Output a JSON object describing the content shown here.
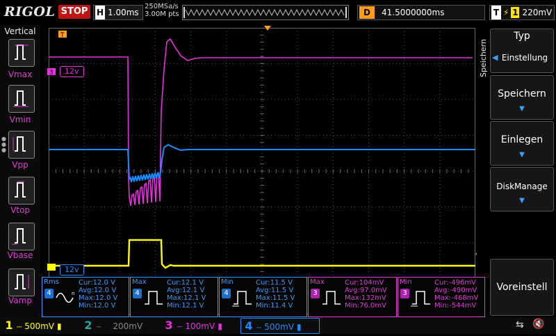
{
  "topbar": {
    "brand": "RIGOL",
    "run_state": "STOP",
    "timebase_key": "H",
    "timebase": "1.00ms",
    "sample_rate": "250MSa/s",
    "memory_depth": "3.00M pts",
    "delay_key": "D",
    "delay": "41.5000000ms",
    "trigger_key": "T",
    "trigger_channel": "1",
    "trigger_level": "220mV",
    "colors": {
      "stop": "#c01515",
      "delay": "#ff9c1a",
      "trigger": "#ffe500"
    }
  },
  "left_panel": {
    "title": "Vertical",
    "items": [
      {
        "label": "Vmax",
        "icon": "vmax-icon"
      },
      {
        "label": "Vmin",
        "icon": "vmin-icon"
      },
      {
        "label": "Vpp",
        "icon": "vpp-icon"
      },
      {
        "label": "Vtop",
        "icon": "vtop-icon"
      },
      {
        "label": "Vbase",
        "icon": "vbase-icon"
      },
      {
        "label": "Vamp",
        "icon": "vamp-icon"
      }
    ]
  },
  "right_menu": {
    "side_title": "Speichern",
    "items": [
      {
        "title": "Typ",
        "value": "Einstellung"
      },
      {
        "title": "Speichern"
      },
      {
        "title": "Einlegen"
      },
      {
        "title": "DiskManage"
      },
      {
        "title": "Voreinstell"
      }
    ]
  },
  "waveform": {
    "ch3_label": "12v",
    "ch4_label": "12v",
    "colors": {
      "ch1": "#ffff00",
      "ch2": "#2aa8a8",
      "ch3": "#e830e0",
      "ch4": "#1a8cff"
    }
  },
  "measurements": [
    {
      "name": "Rms",
      "channel": "4",
      "color": "#3a9cff",
      "icon": "rms-wave-icon",
      "cur": "Cur:12.0 V",
      "avg": "Avg:12.0 V",
      "max": "Max:12.0 V",
      "min": "Min:12.0 V"
    },
    {
      "name": "Max",
      "channel": "4",
      "color": "#3a9cff",
      "icon": "pulse-max-icon",
      "cur": "Cur:12.1 V",
      "avg": "Avg:12.1 V",
      "max": "Max:12.1 V",
      "min": "Min:12.1 V"
    },
    {
      "name": "Min",
      "channel": "4",
      "color": "#3a9cff",
      "icon": "pulse-min-icon",
      "cur": "Cur:11.5 V",
      "avg": "Avg:11.5 V",
      "max": "Max:11.5 V",
      "min": "Min:11.4 V"
    },
    {
      "name": "Max",
      "channel": "3",
      "color": "#e03cd6",
      "icon": "pulse-max-icon",
      "cur": "Cur:104mV",
      "avg": "Avg:97.0mV",
      "max": "Max:132mV",
      "min": "Min:76.0mV"
    },
    {
      "name": "Min",
      "channel": "3",
      "color": "#e03cd6",
      "icon": "pulse-min-icon",
      "cur": "Cur:-496mV",
      "avg": "Avg:-490mV",
      "max": "Max:-468mV",
      "min": "Min:-544mV"
    }
  ],
  "channels": [
    {
      "num": "1",
      "scale": "500mV",
      "color": "#ffff00",
      "active": true
    },
    {
      "num": "2",
      "scale": "200mV",
      "color": "#2aa8a8",
      "active": false
    },
    {
      "num": "3",
      "scale": "100mV",
      "color": "#e830e0",
      "active": true
    },
    {
      "num": "4",
      "scale": "500mV",
      "color": "#1a8cff",
      "active": true
    }
  ]
}
